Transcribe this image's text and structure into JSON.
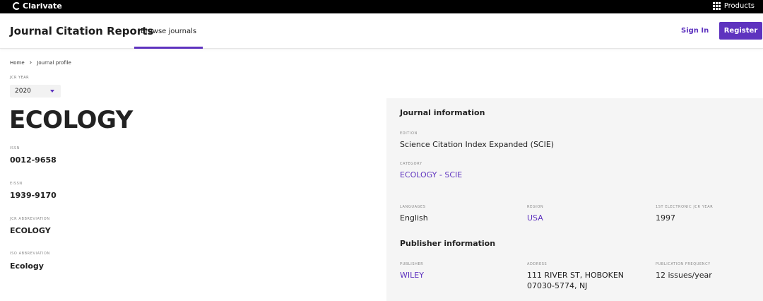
{
  "topbar": {
    "brand": "Clarivate",
    "products_label": "Products"
  },
  "header": {
    "app_title": "Journal Citation Reports",
    "browse_tab": "Browse journals",
    "signin": "Sign In",
    "register": "Register"
  },
  "breadcrumb": {
    "home": "Home",
    "current": "Journal profile"
  },
  "jcr_year": {
    "label": "JCR YEAR",
    "value": "2020"
  },
  "journal": {
    "name": "ECOLOGY",
    "issn_label": "ISSN",
    "issn": "0012-9658",
    "eissn_label": "EISSN",
    "eissn": "1939-9170",
    "jcr_abbr_label": "JCR ABBREVIATION",
    "jcr_abbr": "ECOLOGY",
    "iso_abbr_label": "ISO ABBREVIATION",
    "iso_abbr": "Ecology"
  },
  "journal_info": {
    "heading": "Journal information",
    "edition_label": "EDITION",
    "edition": "Science Citation Index Expanded (SCIE)",
    "category_label": "CATEGORY",
    "category": "ECOLOGY - SCIE",
    "languages_label": "LANGUAGES",
    "languages": "English",
    "region_label": "REGION",
    "region": "USA",
    "first_year_label": "1ST ELECTRONIC JCR YEAR",
    "first_year": "1997"
  },
  "publisher_info": {
    "heading": "Publisher information",
    "publisher_label": "PUBLISHER",
    "publisher": "WILEY",
    "address_label": "ADDRESS",
    "address_line1": "111 RIVER ST, HOBOKEN",
    "address_line2": "07030-5774, NJ",
    "frequency_label": "PUBLICATION FREQUENCY",
    "frequency": "12 issues/year"
  },
  "colors": {
    "accent": "#5e33bf",
    "topbar": "#000000",
    "panel": "#f5f5f5"
  }
}
